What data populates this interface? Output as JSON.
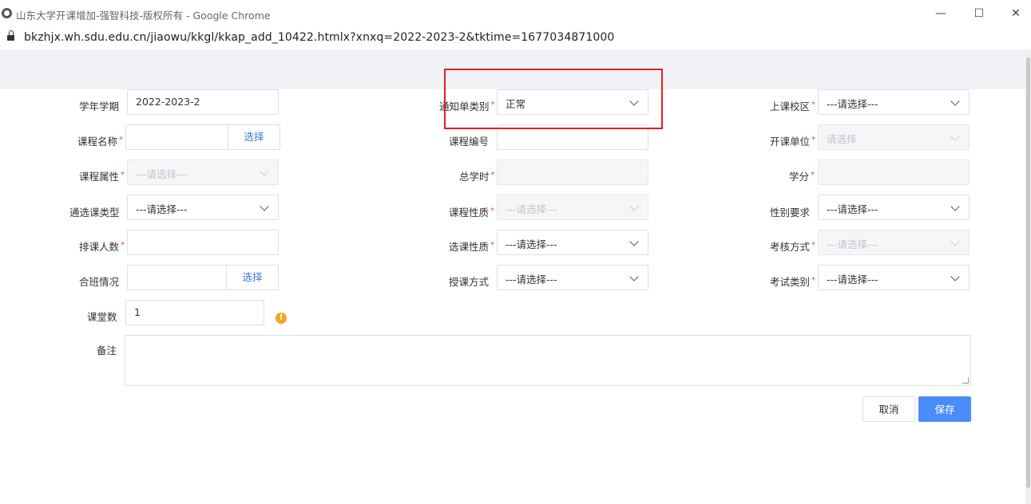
{
  "window": {
    "title": "山东大学开课增加-强智科技-版权所有 - Google Chrome",
    "url": "bkzhjx.wh.sdu.edu.cn/jiaowu/kkgl/kkap_add_10422.htmlx?xnxq=2022-2023-2&tktime=1677034871000",
    "minimize": "—",
    "maximize": "☐",
    "close": "✕"
  },
  "form": {
    "xnxq": {
      "label": "学年学期",
      "value": "2022-2023-2"
    },
    "tzdlb": {
      "label": "通知单类别",
      "value": "正常",
      "required": "*"
    },
    "skxq": {
      "label": "上课校区",
      "value": "---请选择---",
      "required": "*"
    },
    "kcmc": {
      "label": "课程名称",
      "value": "",
      "required": "*",
      "button": "选择"
    },
    "kcbh": {
      "label": "课程编号",
      "value": ""
    },
    "kkdw": {
      "label": "开课单位",
      "value": "请选择",
      "required": "*"
    },
    "kcsx": {
      "label": "课程属性",
      "value": "---请选择---",
      "required": "*"
    },
    "zxs": {
      "label": "总学时",
      "value": "",
      "required": "*"
    },
    "xf": {
      "label": "学分",
      "value": "",
      "required": "*"
    },
    "txklx": {
      "label": "通选课类型",
      "value": "---请选择---"
    },
    "kcxz": {
      "label": "课程性质",
      "value": "---请选择---",
      "required": "*"
    },
    "xbyq": {
      "label": "性别要求",
      "value": "---请选择---"
    },
    "pkrs": {
      "label": "排课人数",
      "value": "",
      "required": "*"
    },
    "xkxz": {
      "label": "选课性质",
      "value": "---请选择---",
      "required": "*"
    },
    "khfs": {
      "label": "考核方式",
      "value": "---请选择---",
      "required": "*"
    },
    "hbqk": {
      "label": "合班情况",
      "value": "",
      "button": "选择"
    },
    "skfs": {
      "label": "授课方式",
      "value": "---请选择---"
    },
    "kslb": {
      "label": "考试类别",
      "value": "---请选择---",
      "required": "*"
    },
    "kts": {
      "label": "课堂数",
      "value": "1",
      "warn": "!"
    },
    "bz": {
      "label": "备注",
      "value": ""
    }
  },
  "actions": {
    "cancel": "取消",
    "save": "保存"
  },
  "colors": {
    "primary": "#4b8df8",
    "required": "#e84a4a",
    "highlight": "#e02020",
    "warning": "#f5a623"
  }
}
